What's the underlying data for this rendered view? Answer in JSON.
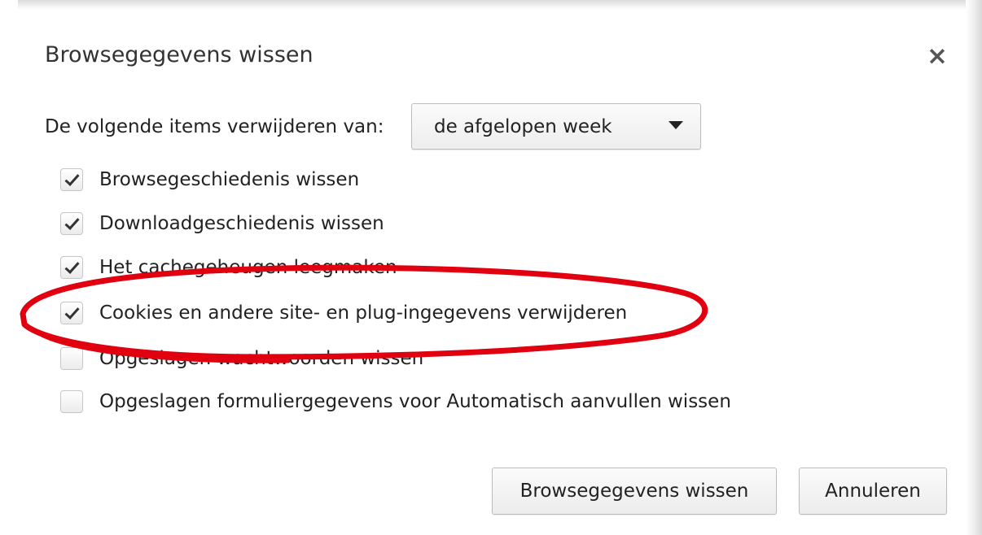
{
  "dialog": {
    "title": "Browsegegevens wissen",
    "close_icon": "close-icon",
    "close_symbol": "×"
  },
  "time_range": {
    "label": "De volgende items verwijderen van:",
    "selected": "de afgelopen week",
    "dropdown_icon": "chevron-down-icon"
  },
  "options": [
    {
      "label": "Browsegeschiedenis wissen",
      "checked": true
    },
    {
      "label": "Downloadgeschiedenis wissen",
      "checked": true
    },
    {
      "label": "Het cachegeheugen leegmaken",
      "checked": true
    },
    {
      "label": "Cookies en andere site- en plug-ingegevens verwijderen",
      "checked": true
    },
    {
      "label": "Opgeslagen wachtwoorden wissen",
      "checked": false
    },
    {
      "label": "Opgeslagen formuliergegevens voor Automatisch aanvullen wissen",
      "checked": false
    }
  ],
  "buttons": {
    "clear": "Browsegegevens wissen",
    "cancel": "Annuleren"
  },
  "annotation": {
    "color": "#e0000f"
  }
}
